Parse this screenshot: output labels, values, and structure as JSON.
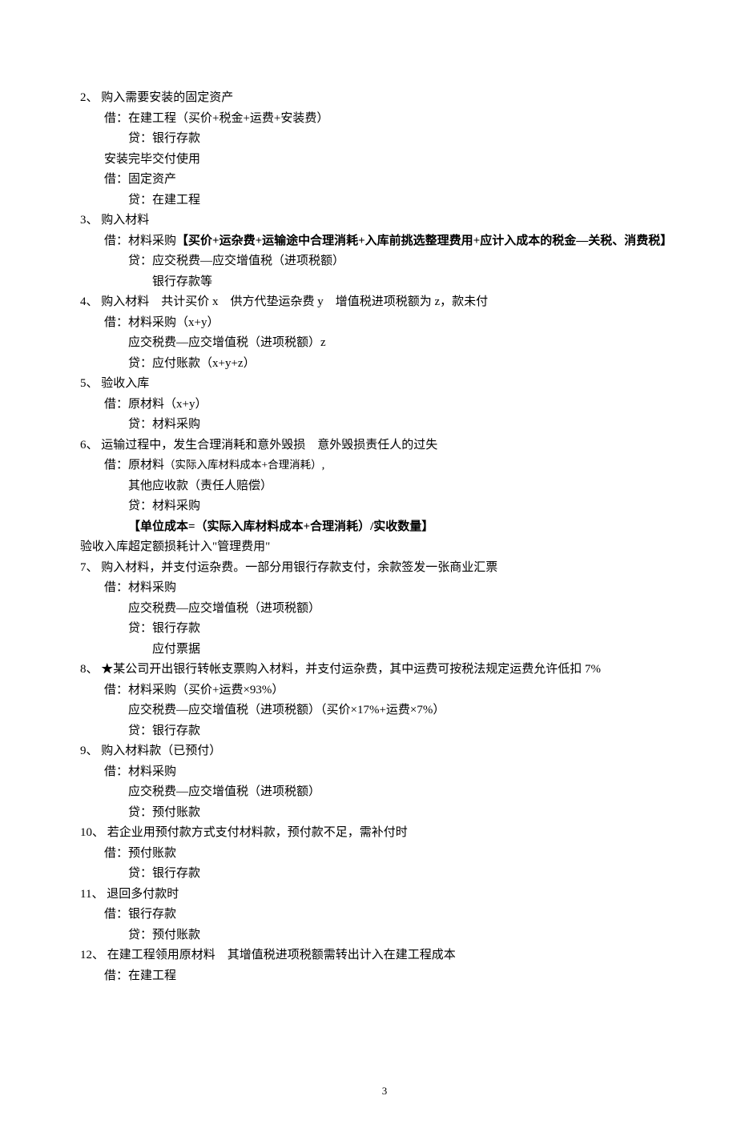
{
  "page_number": "3",
  "entries": [
    {
      "num": "2、",
      "title": "购入需要安装的固定资产",
      "lines": [
        {
          "cls": "ind1",
          "text": "借：在建工程（买价+税金+运费+安装费）"
        },
        {
          "cls": "ind2",
          "text": "贷：银行存款"
        },
        {
          "cls": "ind1",
          "text": "安装完毕交付使用"
        },
        {
          "cls": "ind1",
          "text": "借：固定资产"
        },
        {
          "cls": "ind2",
          "text": "贷：在建工程"
        }
      ]
    },
    {
      "num": "3、",
      "title": "购入材料",
      "lines": [
        {
          "cls": "ind1",
          "html": "借：材料采购<span class=\"bold\">【买价+运杂费+运输途中合理消耗+入库前挑选整理费用+应计入成本的税金—关税、消费税】</span>"
        },
        {
          "cls": "ind2",
          "text": "贷：应交税费—应交增值税（进项税额）"
        },
        {
          "cls": "ind3",
          "text": "银行存款等"
        }
      ]
    },
    {
      "num": "4、",
      "title": "购入材料　共计买价 x　供方代垫运杂费 y　增值税进项税额为 z，款未付",
      "lines": [
        {
          "cls": "ind1",
          "text": "借：材料采购（x+y）"
        },
        {
          "cls": "ind2",
          "text": "应交税费—应交增值税（进项税额）z"
        },
        {
          "cls": "ind2",
          "text": "贷：应付账款（x+y+z）"
        }
      ]
    },
    {
      "num": "5、",
      "title": "验收入库",
      "lines": [
        {
          "cls": "ind1",
          "text": "借：原材料（x+y）"
        },
        {
          "cls": "ind2",
          "text": "贷：材料采购"
        }
      ]
    },
    {
      "num": "6、",
      "title": "运输过程中，发生合理消耗和意外毁损　意外毁损责任人的过失",
      "lines": [
        {
          "cls": "ind1",
          "html": "借：原材料<span class=\"small\">（实际入库材料成本+合理消耗）</span>,"
        },
        {
          "cls": "ind2",
          "text": "其他应收款（责任人赔偿）"
        },
        {
          "cls": "ind2",
          "text": "贷：材料采购"
        },
        {
          "cls": "ind2 bold",
          "text": "【单位成本=（实际入库材料成本+合理消耗）/实收数量】"
        },
        {
          "cls": "",
          "text": "验收入库超定额损耗计入\"管理费用\""
        }
      ]
    },
    {
      "num": "7、",
      "title": "购入材料，并支付运杂费。一部分用银行存款支付，余款签发一张商业汇票",
      "lines": [
        {
          "cls": "ind1",
          "text": "借：材料采购"
        },
        {
          "cls": "ind2",
          "text": "应交税费—应交增值税（进项税额）"
        },
        {
          "cls": "ind2",
          "text": "贷：银行存款"
        },
        {
          "cls": "ind3",
          "text": "应付票据"
        }
      ]
    },
    {
      "num": "8、",
      "title": "★某公司开出银行转帐支票购入材料，并支付运杂费，其中运费可按税法规定运费允许低扣 7%",
      "lines": [
        {
          "cls": "ind1",
          "text": "借：材料采购（买价+运费×93%）"
        },
        {
          "cls": "ind2",
          "text": "应交税费—应交增值税（进项税额）（买价×17%+运费×7%）"
        },
        {
          "cls": "ind2",
          "text": "贷：银行存款"
        }
      ]
    },
    {
      "num": "9、",
      "title": "购入材料款（已预付）",
      "lines": [
        {
          "cls": "ind1",
          "text": "借：材料采购"
        },
        {
          "cls": "ind2",
          "text": "应交税费—应交增值税（进项税额）"
        },
        {
          "cls": "ind2",
          "text": "贷：预付账款"
        }
      ]
    },
    {
      "num": "10、",
      "title": "若企业用预付款方式支付材料款，预付款不足，需补付时",
      "lines": [
        {
          "cls": "ind1",
          "text": "借：预付账款"
        },
        {
          "cls": "ind2",
          "text": "贷：银行存款"
        }
      ]
    },
    {
      "num": "11、",
      "title": "退回多付款时",
      "lines": [
        {
          "cls": "ind1",
          "text": "借：银行存款"
        },
        {
          "cls": "ind2",
          "text": "贷：预付账款"
        }
      ]
    },
    {
      "num": "12、",
      "title": "在建工程领用原材料　其增值税进项税额需转出计入在建工程成本",
      "lines": [
        {
          "cls": "ind1",
          "text": "借：在建工程"
        }
      ]
    }
  ]
}
